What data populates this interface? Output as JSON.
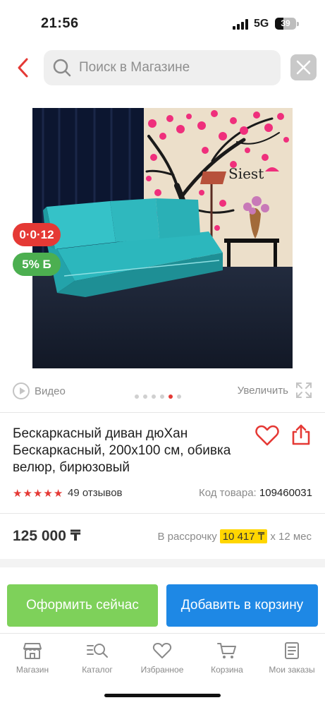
{
  "status_bar": {
    "time": "21:56",
    "network": "5G",
    "battery": "39",
    "battery_level": 0.39
  },
  "search": {
    "placeholder": "Поиск в Магазине"
  },
  "badges": {
    "timer": "0·0·12",
    "bonus": "5% Б"
  },
  "image_sign_text": "Siest",
  "media": {
    "video_label": "Видео",
    "zoom_label": "Увеличить",
    "slides_total": 6,
    "slide_active": 5
  },
  "product": {
    "title": "Бескаркасный диван дюХан Бескаркасный, 200х100 см, обивка велюр, бирюзовый",
    "rating": 5,
    "reviews": "49 отзывов",
    "code_label": "Код товара:",
    "code": "109460031",
    "price": "125 000 ₸",
    "installment_prefix": "В рассрочку",
    "installment_amount": "10 417 ₸",
    "installment_suffix": "х 12 мес"
  },
  "actions": {
    "buy_now": "Оформить сейчас",
    "add_to_cart": "Добавить в корзину"
  },
  "tabs": [
    {
      "label": "Магазин",
      "icon": "shop-icon"
    },
    {
      "label": "Каталог",
      "icon": "catalog-search-icon"
    },
    {
      "label": "Избранное",
      "icon": "heart-icon"
    },
    {
      "label": "Корзина",
      "icon": "cart-icon"
    },
    {
      "label": "Мои заказы",
      "icon": "orders-icon"
    }
  ],
  "colors": {
    "accent_red": "#e53935",
    "green_button": "#7ed15a",
    "blue_button": "#1e88e5",
    "installment_highlight": "#ffd600",
    "bonus_green": "#4caf50"
  }
}
